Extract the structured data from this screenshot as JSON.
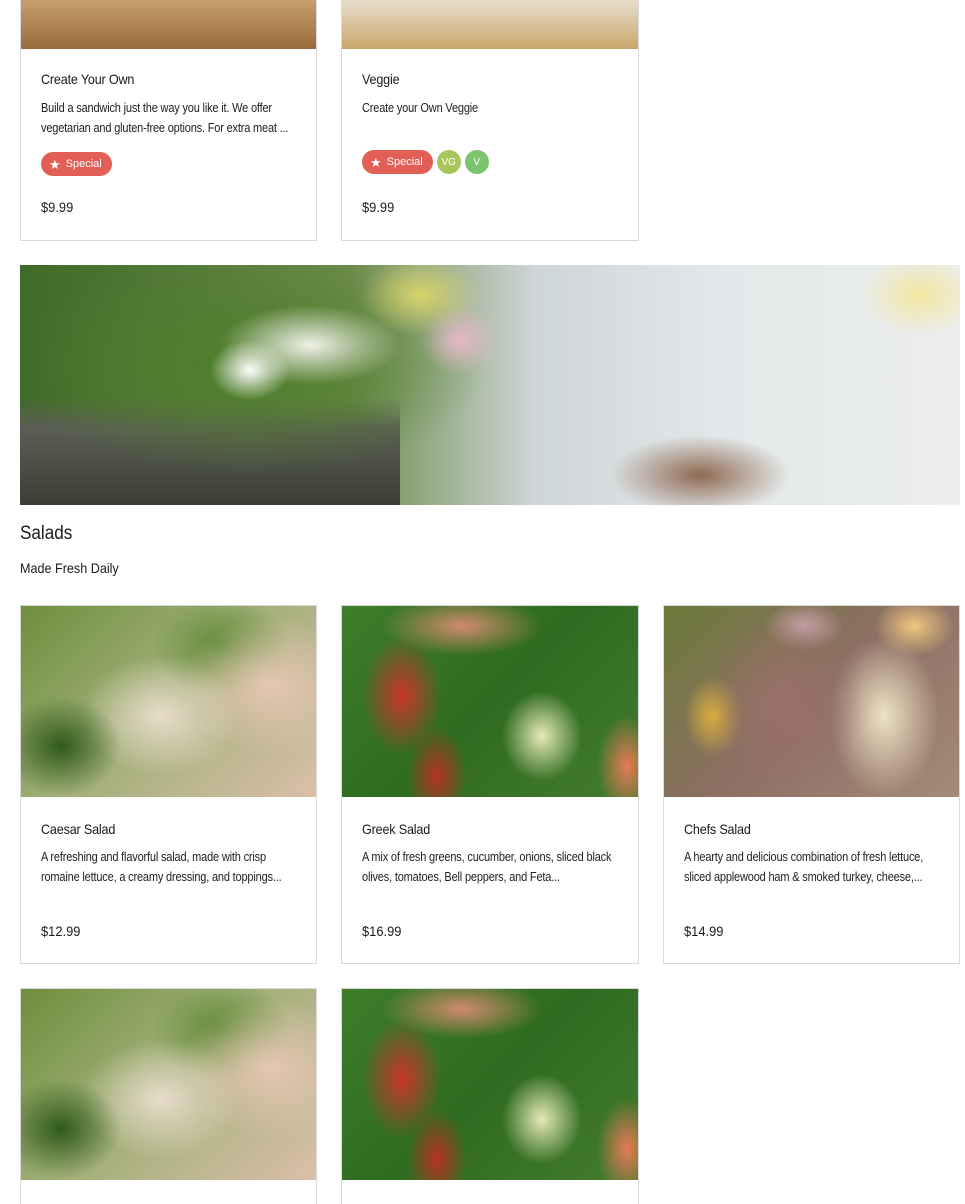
{
  "sandwich_cards": [
    {
      "title": "Create Your Own",
      "description": "Build a sandwich just the way you like it. We offer vegetarian and gluten-free options. For extra meat ...",
      "price": "$9.99",
      "badges": {
        "special": "Special"
      }
    },
    {
      "title": "Veggie",
      "description": "Create your Own Veggie",
      "price": "$9.99",
      "badges": {
        "special": "Special",
        "diet": [
          "VG",
          "V"
        ]
      }
    }
  ],
  "salads_section": {
    "title": "Salads",
    "subtitle": "Made Fresh Daily"
  },
  "salad_cards": [
    {
      "title": "Caesar Salad",
      "description": "A refreshing and flavorful salad, made with crisp romaine lettuce, a creamy dressing, and toppings...",
      "price": "$12.99"
    },
    {
      "title": "Greek Salad",
      "description": "A mix of fresh greens, cucumber, onions, sliced black olives, tomatoes, Bell peppers, and Feta...",
      "price": "$16.99"
    },
    {
      "title": "Chefs Salad",
      "description": "A hearty and delicious combination of fresh lettuce, sliced applewood ham & smoked turkey, cheese,...",
      "price": "$14.99"
    }
  ],
  "colors": {
    "special_badge": "#e25f55",
    "vegan_badge": "#a7c55a",
    "vegetarian_badge": "#7cc36e",
    "card_border": "#d9d9d9"
  }
}
